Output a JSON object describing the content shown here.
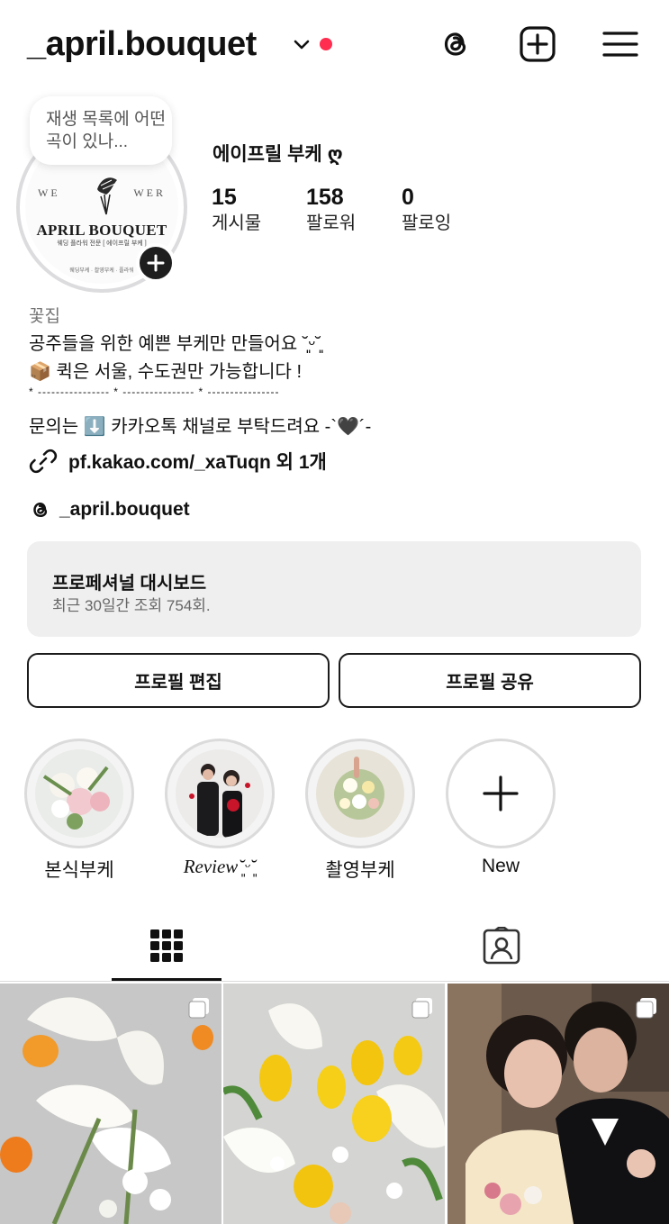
{
  "header": {
    "username": "_april.bouquet",
    "icons": [
      "chevron-down-icon",
      "threads-icon",
      "create-post-icon",
      "menu-icon"
    ],
    "notification_dot_color": "#ff2d4f"
  },
  "profile": {
    "note_bubble": "재생 목록에 어떤 곡이 있나...",
    "avatar_logo": {
      "title": "APRIL BOUQUET",
      "subtitle": "웨딩 플라워 전문 [ 에이프릴 부케 ]",
      "footer": "웨딩부케 · 촬영부케 · 플라워",
      "arc_left": "WE",
      "arc_right": "WER"
    },
    "display_name": "에이프릴 부케 ღ",
    "stats": [
      {
        "num": "15",
        "label": "게시물"
      },
      {
        "num": "158",
        "label": "팔로워"
      },
      {
        "num": "0",
        "label": "팔로잉"
      }
    ]
  },
  "bio": {
    "category": "꽃집",
    "line1": "공주들을 위한 예쁜 부케만 만들어요 ˘͈ᵕ˘͈",
    "line2": "📦 퀵은 서울, 수도권만 가능합니다 !",
    "divider": "* ---------------- * ---------------- * ----------------",
    "line3": "문의는 ⬇️ 카카오톡 채널로 부탁드려요 -`🖤´-",
    "link": "pf.kakao.com/_xaTuqn 외 1개",
    "threads_handle": "_april.bouquet"
  },
  "dashboard": {
    "title": "프로페셔널 대시보드",
    "subtitle": "최근 30일간 조회 754회."
  },
  "buttons": {
    "edit_profile": "프로필 편집",
    "share_profile": "프로필 공유"
  },
  "highlights": [
    {
      "label": "본식부케"
    },
    {
      "label": "Review˘͈ᵕ˘͈"
    },
    {
      "label": "촬영부케"
    },
    {
      "label": "New"
    }
  ],
  "tabs": [
    {
      "name": "grid",
      "icon": "grid-icon",
      "active": true
    },
    {
      "name": "tagged",
      "icon": "tagged-icon",
      "active": false
    }
  ]
}
